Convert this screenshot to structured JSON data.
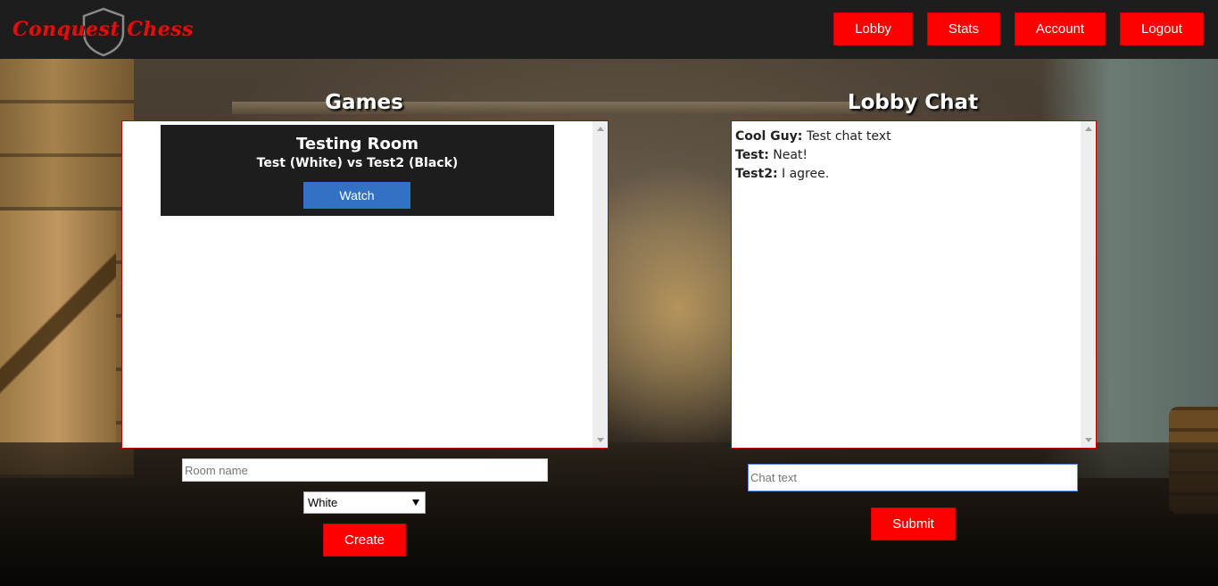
{
  "app": {
    "logo_text": "Conquest Chess"
  },
  "nav": {
    "lobby": "Lobby",
    "stats": "Stats",
    "account": "Account",
    "logout": "Logout"
  },
  "games": {
    "heading": "Games",
    "rooms": [
      {
        "title": "Testing Room",
        "players": "Test (White) vs Test2 (Black)",
        "watch_label": "Watch"
      }
    ],
    "room_name_placeholder": "Room name",
    "color_select": {
      "selected": "White"
    },
    "create_label": "Create"
  },
  "chat": {
    "heading": "Lobby Chat",
    "messages": [
      {
        "user": "Cool Guy:",
        "text": "Test chat text"
      },
      {
        "user": "Test:",
        "text": "Neat!"
      },
      {
        "user": "Test2:",
        "text": "I agree."
      }
    ],
    "input_placeholder": "Chat text",
    "submit_label": "Submit"
  },
  "colors": {
    "header_bg": "#1d1d1d",
    "accent_red": "#ff0000",
    "watch_blue": "#3272c4"
  }
}
